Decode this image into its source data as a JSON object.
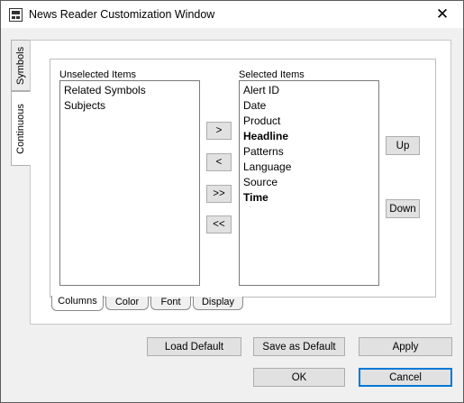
{
  "window": {
    "title": "News Reader Customization Window",
    "close_glyph": "✕"
  },
  "side_tabs": [
    {
      "label": "Symbols",
      "selected": false
    },
    {
      "label": "Continuous",
      "selected": true
    }
  ],
  "columns": {
    "unselected_label": "Unselected Items",
    "selected_label": "Selected Items",
    "unselected_items": [
      {
        "label": "Related Symbols",
        "bold": false
      },
      {
        "label": "Subjects",
        "bold": false
      }
    ],
    "selected_items": [
      {
        "label": "Alert ID",
        "bold": false
      },
      {
        "label": "Date",
        "bold": false
      },
      {
        "label": "Product",
        "bold": false
      },
      {
        "label": "Headline",
        "bold": true
      },
      {
        "label": "Patterns",
        "bold": false
      },
      {
        "label": "Language",
        "bold": false
      },
      {
        "label": "Source",
        "bold": false
      },
      {
        "label": "Time",
        "bold": true
      }
    ],
    "move_buttons": {
      "add": ">",
      "remove": "<",
      "add_all": ">>",
      "remove_all": "<<"
    },
    "order_buttons": {
      "up": "Up",
      "down": "Down"
    }
  },
  "bottom_tabs": [
    {
      "label": "Columns",
      "selected": true
    },
    {
      "label": "Color",
      "selected": false
    },
    {
      "label": "Font",
      "selected": false
    },
    {
      "label": "Display",
      "selected": false
    }
  ],
  "actions": {
    "load_default": "Load Default",
    "save_as_default": "Save as Default",
    "apply": "Apply",
    "ok": "OK",
    "cancel": "Cancel"
  }
}
